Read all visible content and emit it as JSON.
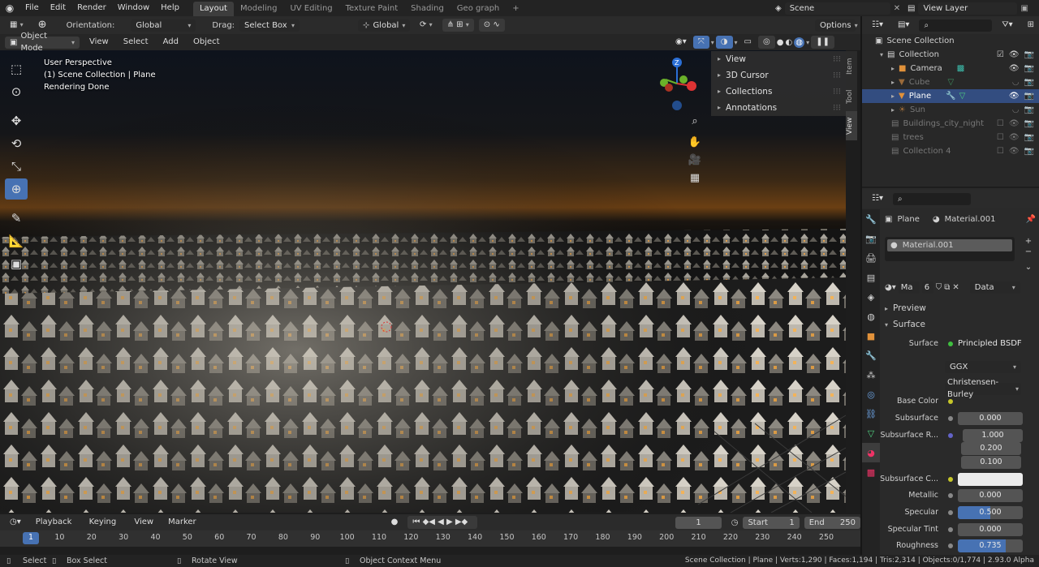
{
  "topbar": {
    "menus": [
      "File",
      "Edit",
      "Render",
      "Window",
      "Help"
    ],
    "workspaces": [
      "Layout",
      "Modeling",
      "UV Editing",
      "Texture Paint",
      "Shading",
      "Geo graph"
    ],
    "active_workspace": "Layout",
    "add_tab": "+",
    "scene": "Scene",
    "view_layer": "View Layer"
  },
  "tool_header": {
    "orientation_label": "Orientation:",
    "orientation_value": "Global",
    "drag_label": "Drag:",
    "drag_value": "Select Box",
    "transform_orientation": "Global",
    "options": "Options"
  },
  "viewport_header": {
    "mode": "Object Mode",
    "menus": [
      "View",
      "Select",
      "Add",
      "Object"
    ]
  },
  "viewport_overlay": {
    "line1": "User Perspective",
    "line2": "(1) Scene Collection | Plane",
    "line3": "Rendering Done"
  },
  "n_panel": {
    "sections": [
      "View",
      "3D Cursor",
      "Collections",
      "Annotations"
    ],
    "tabs": [
      "Item",
      "Tool",
      "View"
    ],
    "active_tab": "View"
  },
  "gizmo": {
    "z": "Z"
  },
  "outliner": {
    "root": "Scene Collection",
    "items": [
      {
        "name": "Collection",
        "indent": 1
      },
      {
        "name": "Camera",
        "indent": 2
      },
      {
        "name": "Cube",
        "indent": 2
      },
      {
        "name": "Plane",
        "indent": 2
      },
      {
        "name": "Sun",
        "indent": 2
      },
      {
        "name": "Buildings_city_night",
        "indent": 1
      },
      {
        "name": "trees",
        "indent": 1
      },
      {
        "name": "Collection 4",
        "indent": 1
      }
    ]
  },
  "properties": {
    "object": "Plane",
    "material": "Material.001",
    "slot": "Material.001",
    "mat_short": "Ma",
    "users": "6",
    "link": "Data",
    "panels": [
      "Preview",
      "Surface"
    ],
    "surface_label": "Surface",
    "surface_shader": "Principled BSDF",
    "distribution": "GGX",
    "subsurface_method": "Christensen-Burley",
    "fields": {
      "base_color": "Base Color",
      "subsurface": {
        "label": "Subsurface",
        "value": "0.000"
      },
      "subsurface_radius": {
        "label": "Subsurface R...",
        "values": [
          "1.000",
          "0.200",
          "0.100"
        ]
      },
      "subsurface_color": "Subsurface C...",
      "metallic": {
        "label": "Metallic",
        "value": "0.000"
      },
      "specular": {
        "label": "Specular",
        "value": "0.500",
        "fraction": 0.5
      },
      "specular_tint": {
        "label": "Specular Tint",
        "value": "0.000"
      },
      "roughness": {
        "label": "Roughness",
        "value": "0.735",
        "fraction": 0.735
      }
    }
  },
  "timeline": {
    "menus": [
      "Playback",
      "Keying",
      "View",
      "Marker"
    ],
    "current_frame": "1",
    "start_label": "Start",
    "start": "1",
    "end_label": "End",
    "end": "250",
    "ticks": [
      "1",
      "10",
      "20",
      "30",
      "40",
      "50",
      "60",
      "70",
      "80",
      "90",
      "100",
      "110",
      "120",
      "130",
      "140",
      "150",
      "160",
      "170",
      "180",
      "190",
      "200",
      "210",
      "220",
      "230",
      "240",
      "250"
    ]
  },
  "statusbar": {
    "select": "Select",
    "box_select": "Box Select",
    "rotate": "Rotate View",
    "context": "Object Context Menu",
    "stats": "Scene Collection | Plane | Verts:1,290 | Faces:1,194 | Tris:2,314 | Objects:0/1,774 | 2.93.0 Alpha"
  }
}
